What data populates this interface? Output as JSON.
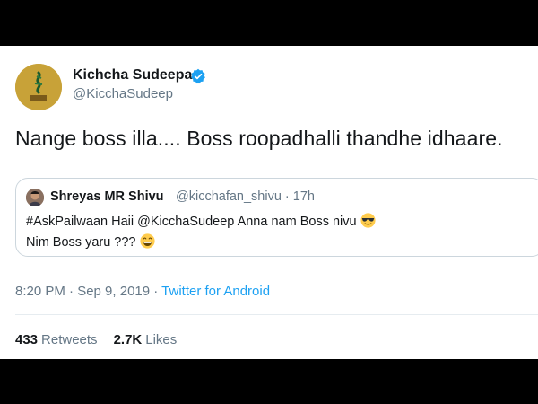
{
  "tweet": {
    "display_name": "Kichcha Sudeepa",
    "handle": "@KicchaSudeep",
    "verified": true,
    "text": "Nange boss illa.... Boss roopadhalli thandhe idhaare.",
    "timestamp": "8:20 PM · Sep 9, 2019",
    "separator": " · ",
    "source": "Twitter for Android"
  },
  "quoted_tweet": {
    "display_name": "Shreyas MR Shivu",
    "handle_time": "@kicchafan_shivu · 17h",
    "line1": "#AskPailwaan Haii @KicchaSudeep Anna nam Boss nivu",
    "line2": "Nim Boss yaru ???",
    "line1_emoji": "sunglasses-emoji",
    "line2_emoji": "grinning-emoji"
  },
  "stats": {
    "retweets_count": "433",
    "retweets_label": "Retweets",
    "likes_count": "2.7K",
    "likes_label": "Likes"
  },
  "colors": {
    "text": "#14171a",
    "secondary": "#657786",
    "link": "#1da1f2",
    "border": "#ccd6dd",
    "avatar_gold": "#c9a43c"
  }
}
